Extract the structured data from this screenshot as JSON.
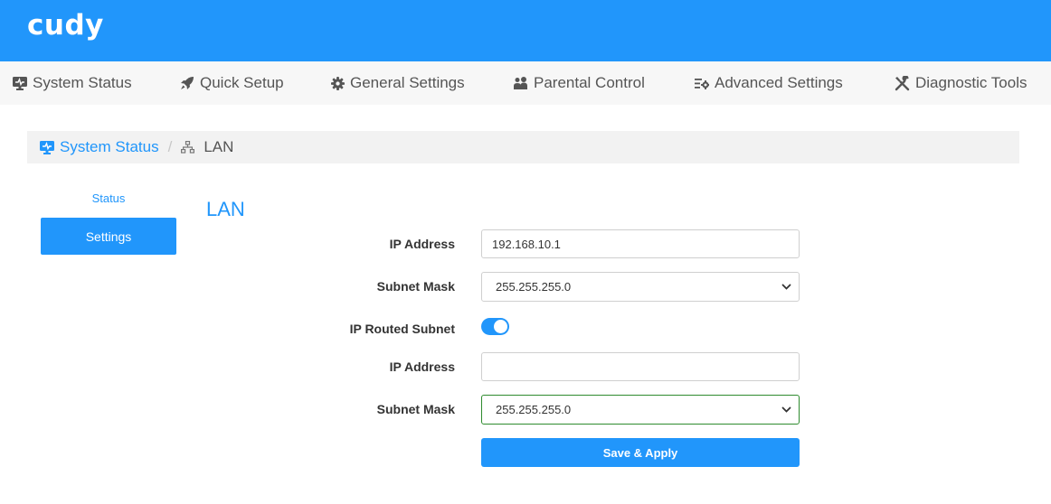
{
  "header": {
    "logo": "cudy",
    "color": "#2196fb"
  },
  "nav": {
    "items": [
      {
        "label": "System Status",
        "icon": "monitor-icon"
      },
      {
        "label": "Quick Setup",
        "icon": "rocket-icon"
      },
      {
        "label": "General Settings",
        "icon": "gear-icon"
      },
      {
        "label": "Parental Control",
        "icon": "users-icon"
      },
      {
        "label": "Advanced Settings",
        "icon": "list-gear-icon"
      },
      {
        "label": "Diagnostic Tools",
        "icon": "tools-icon"
      }
    ]
  },
  "breadcrumb": {
    "parent": "System Status",
    "separator": "/",
    "current": "LAN"
  },
  "sidebar": {
    "items": [
      {
        "label": "Status",
        "active": false
      },
      {
        "label": "Settings",
        "active": true
      }
    ]
  },
  "form": {
    "title": "LAN",
    "ip_address": {
      "label": "IP Address",
      "value": "192.168.10.1"
    },
    "subnet_mask": {
      "label": "Subnet Mask",
      "value": "255.255.255.0"
    },
    "ip_routed_subnet": {
      "label": "IP Routed Subnet",
      "enabled": true
    },
    "routed_ip_address": {
      "label": "IP Address",
      "value": ""
    },
    "routed_subnet_mask": {
      "label": "Subnet Mask",
      "value": "255.255.255.0"
    },
    "save_label": "Save & Apply"
  }
}
